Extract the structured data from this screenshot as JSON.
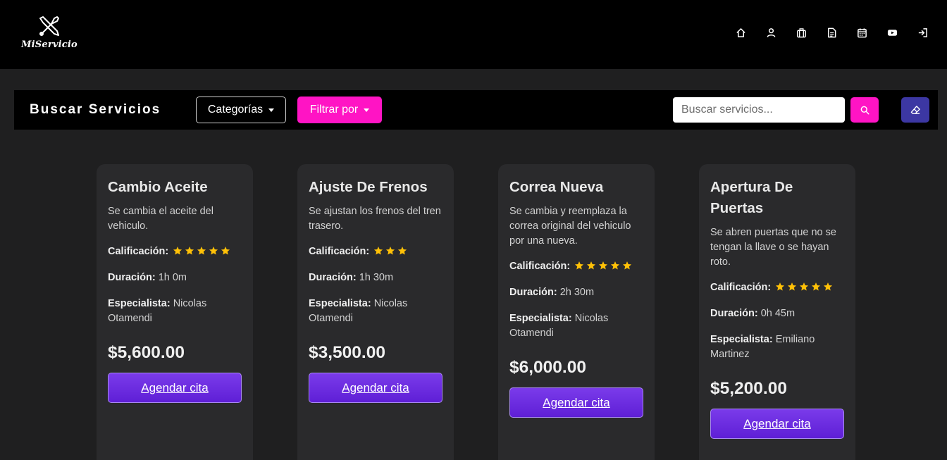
{
  "header": {
    "logo_text": "MiServicio",
    "nav": [
      {
        "name": "home-icon"
      },
      {
        "name": "user-icon"
      },
      {
        "name": "briefcase-icon"
      },
      {
        "name": "document-icon"
      },
      {
        "name": "calendar-icon"
      },
      {
        "name": "youtube-icon"
      },
      {
        "name": "logout-icon"
      }
    ]
  },
  "search": {
    "title": "Buscar Servicios",
    "categories_label": "Categorías",
    "filter_label": "Filtrar por",
    "placeholder": "Buscar servicios...",
    "search_icon": "search-icon",
    "clear_icon": "eraser-icon"
  },
  "colors": {
    "accent_pink": "#ff14c4",
    "accent_purple": "#6a2ae0",
    "clear_button": "#3c37a3",
    "star": "#ffc107"
  },
  "labels": {
    "rating": "Calificación:",
    "duration": "Duración:",
    "specialist": "Especialista:",
    "book": "Agendar cita"
  },
  "services": [
    {
      "title": "Cambio Aceite",
      "description": "Se cambia el aceite del vehiculo.",
      "rating": 5,
      "duration": "1h 0m",
      "specialist": "Nicolas Otamendi",
      "price": "$5,600.00"
    },
    {
      "title": "Ajuste De Frenos",
      "description": "Se ajustan los frenos del tren trasero.",
      "rating": 3,
      "duration": "1h 30m",
      "specialist": "Nicolas Otamendi",
      "price": "$3,500.00"
    },
    {
      "title": "Correa Nueva",
      "description": "Se cambia y reemplaza la correa original del vehiculo por una nueva.",
      "rating": 5,
      "duration": "2h 30m",
      "specialist": "Nicolas Otamendi",
      "price": "$6,000.00"
    },
    {
      "title": "Apertura De Puertas",
      "description": "Se abren puertas que no se tengan la llave o se hayan roto.",
      "rating": 5,
      "duration": "0h 45m",
      "specialist": "Emiliano Martinez",
      "price": "$5,200.00"
    }
  ]
}
